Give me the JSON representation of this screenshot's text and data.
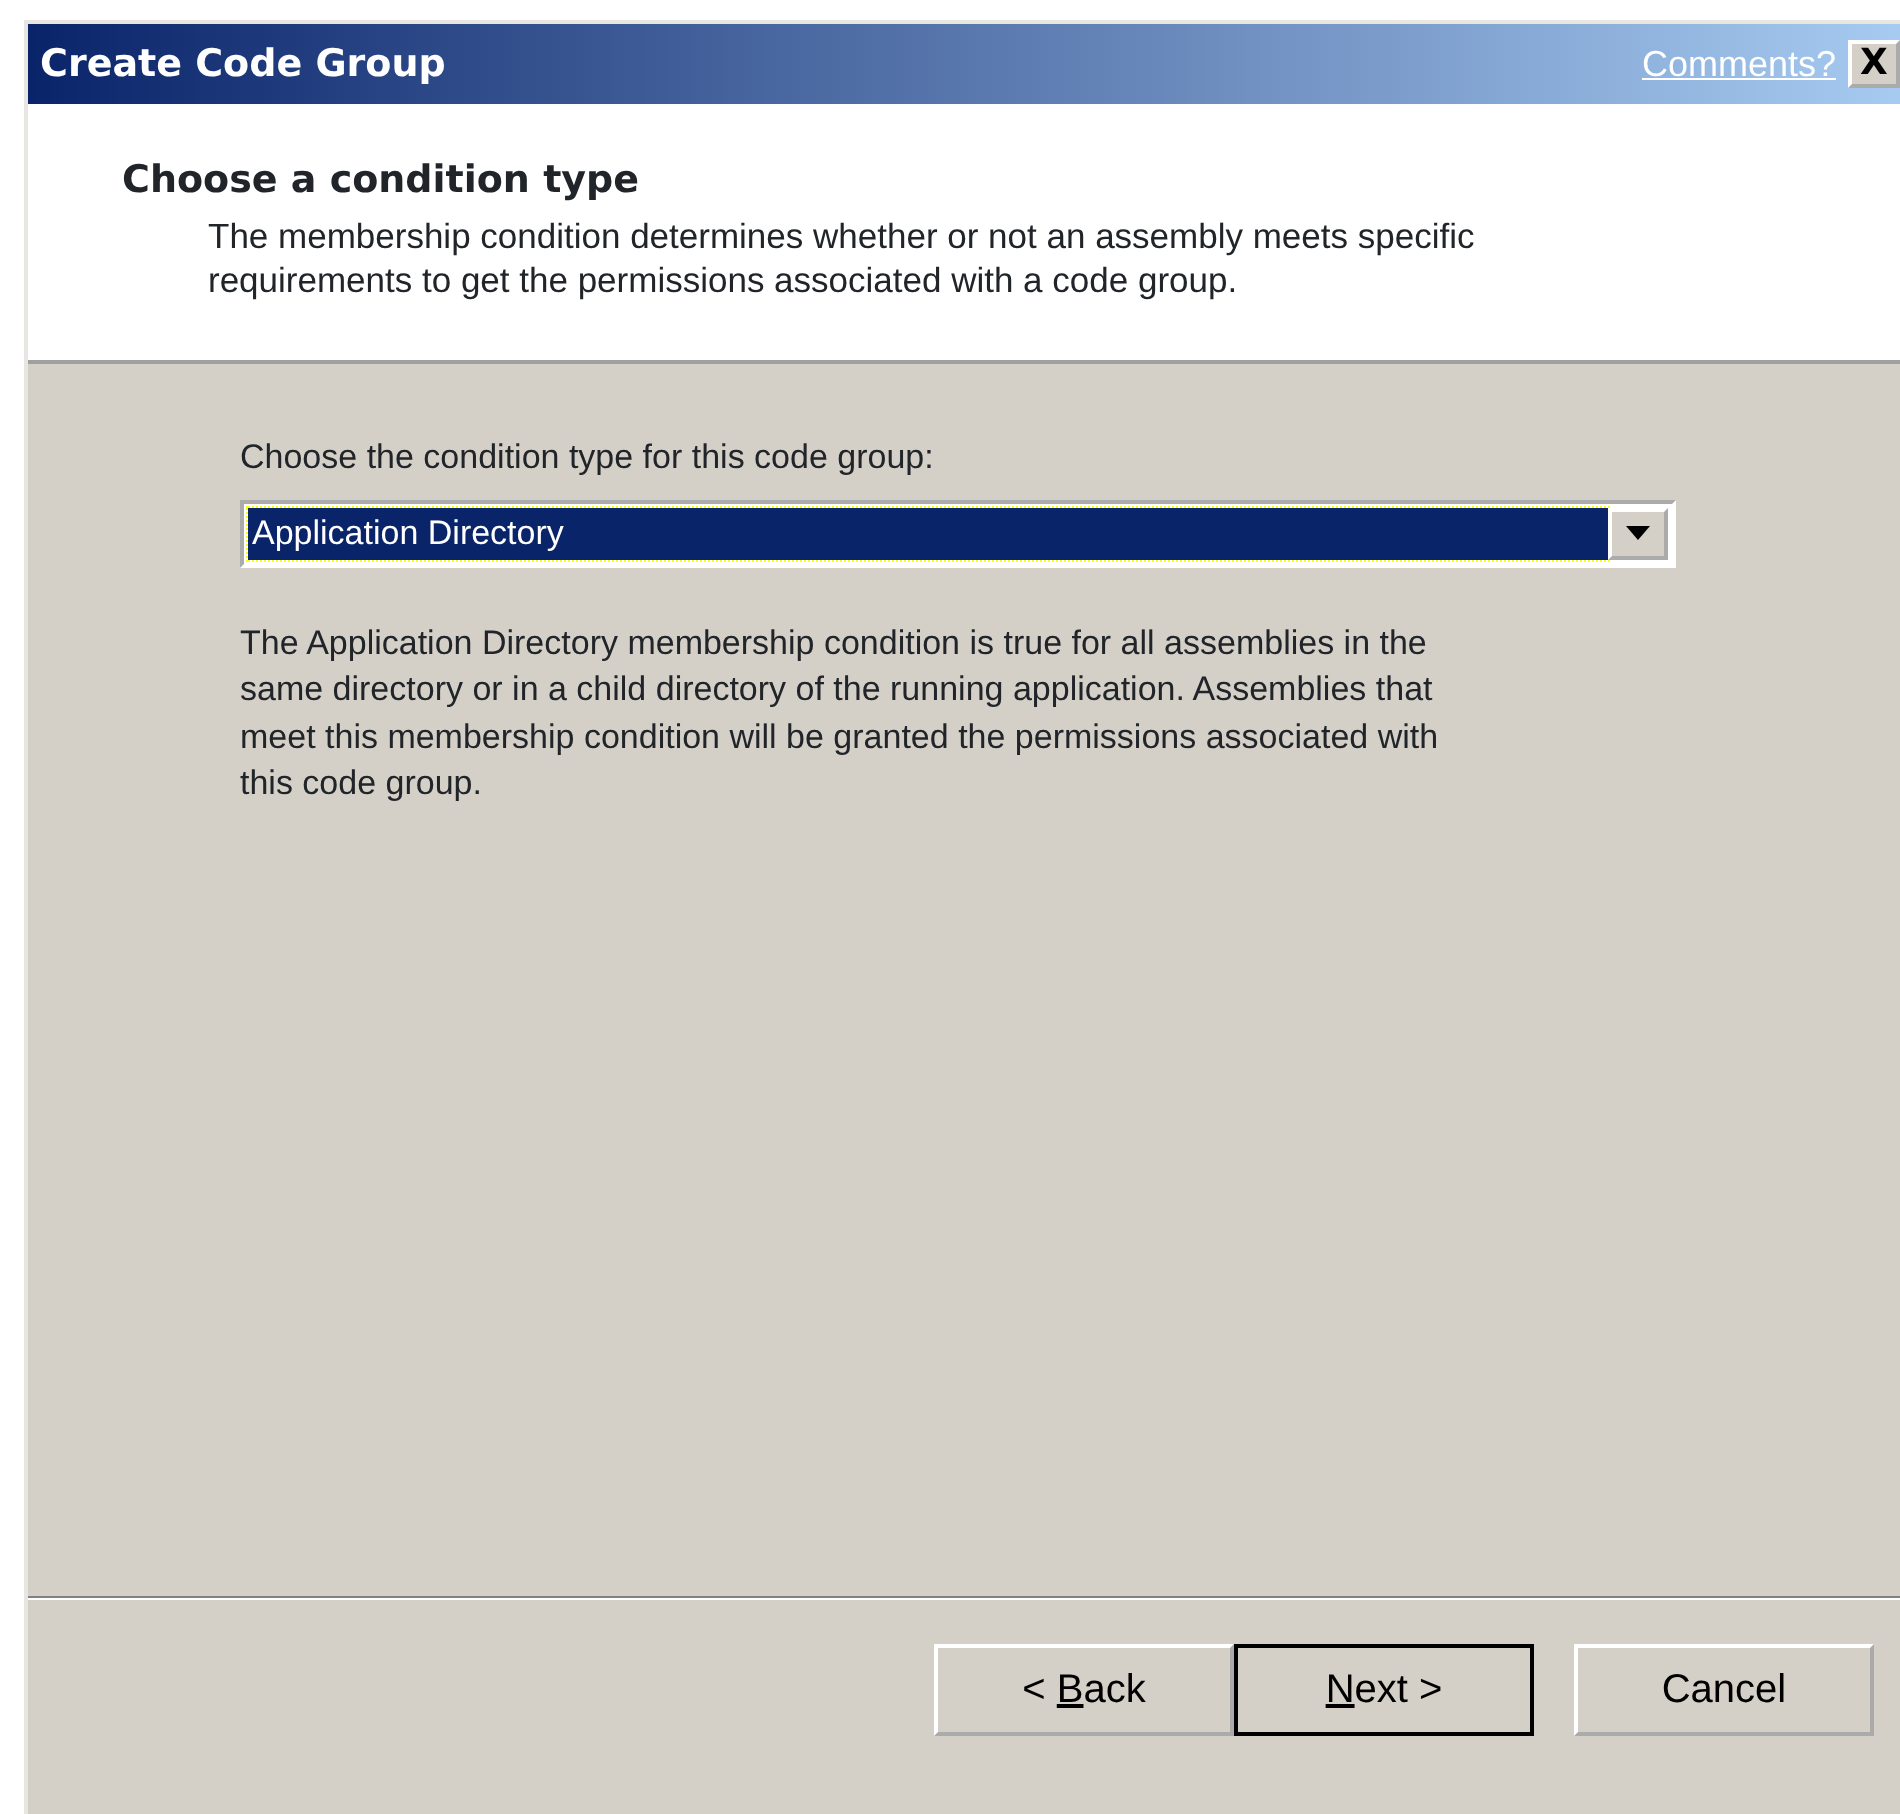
{
  "window": {
    "title": "Create Code Group",
    "comments_link": "Comments?",
    "close": "X"
  },
  "header": {
    "title": "Choose a condition type",
    "description": "The membership condition determines whether or not an assembly meets specific requirements to get the permissions associated with a code group."
  },
  "condition": {
    "label": "Choose the condition type for this code group:",
    "value": "Application Directory",
    "focused": true,
    "description": "The Application Directory membership condition is true for all assemblies in the same directory or in a child directory of the running application.  Assemblies that meet this membership condition will be granted the permissions associated with this code group."
  },
  "buttons": [
    {
      "before": "< ",
      "key": "B",
      "after": "ack",
      "default": false
    },
    {
      "key": "N",
      "after": "ext >",
      "default": true
    },
    {
      "before": "Cancel",
      "default": false
    }
  ]
}
